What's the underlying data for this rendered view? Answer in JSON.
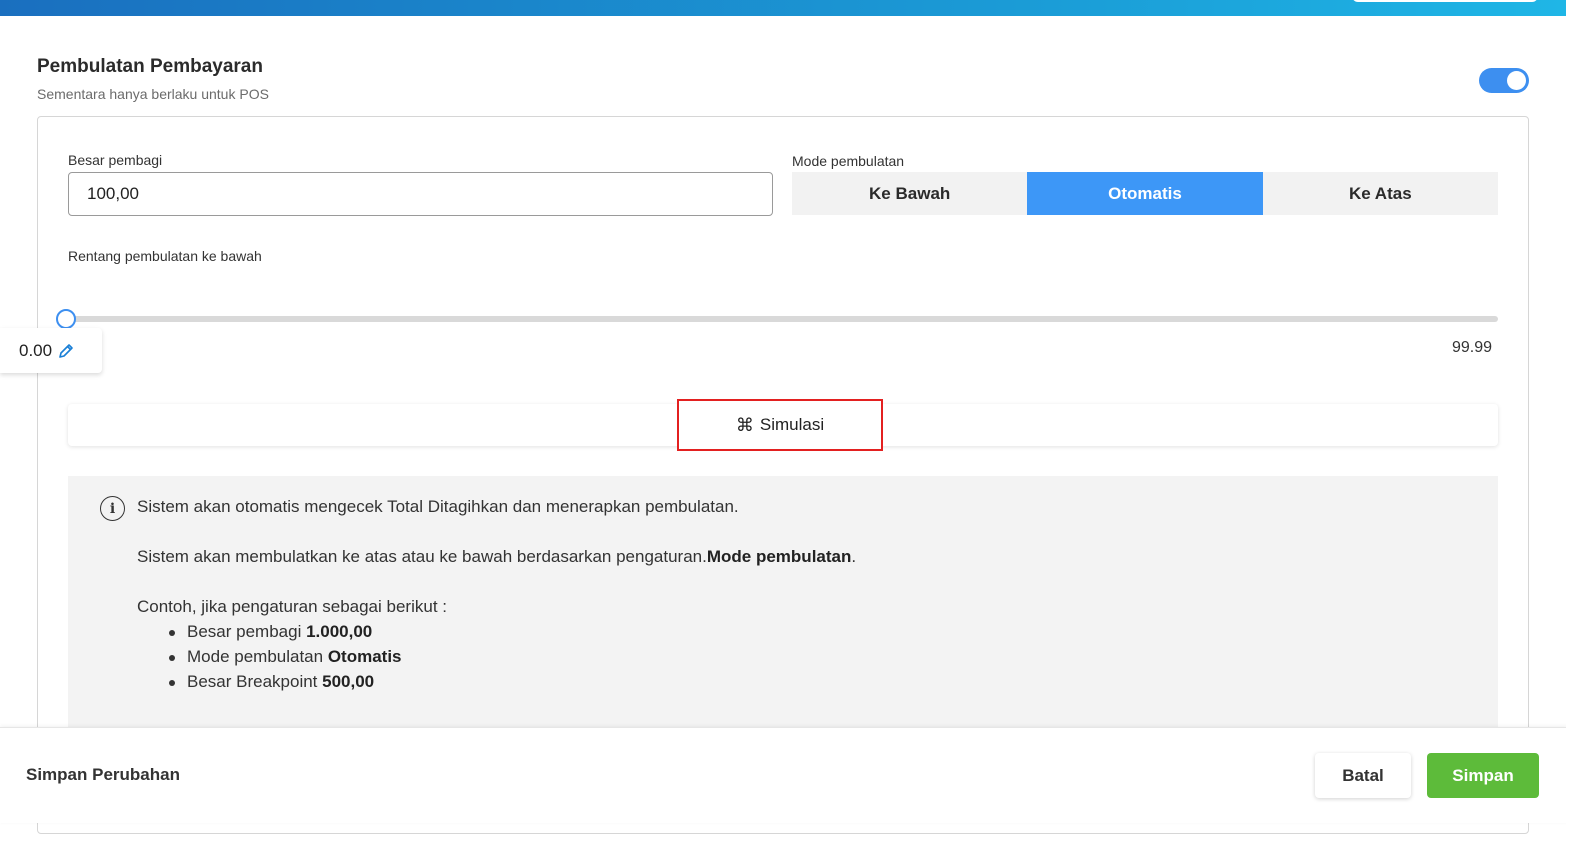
{
  "header": {
    "title": "Pembulatan Pembayaran",
    "subtitle": "Sementara hanya berlaku untuk POS",
    "toggle_enabled": true
  },
  "form": {
    "divisor_label": "Besar pembagi",
    "divisor_value": "100,00",
    "mode_label": "Mode pembulatan",
    "modes": [
      "Ke Bawah",
      "Otomatis",
      "Ke Atas"
    ],
    "selected_mode": "Otomatis",
    "range_label": "Rentang pembulatan ke bawah",
    "range_min": "0.00",
    "range_max": "99.99",
    "range_value": 0
  },
  "simulation": {
    "button_label": "Simulasi",
    "icon": "command-icon"
  },
  "info": {
    "icon": "info-icon",
    "line1": "Sistem akan otomatis mengecek Total Ditagihkan dan menerapkan pembulatan.",
    "line2_prefix": "Sistem akan membulatkan ke atas atau ke bawah berdasarkan pengaturan.",
    "line2_bold": "Mode pembulatan",
    "line2_suffix": ".",
    "example_intro": "Contoh, jika pengaturan sebagai berikut :",
    "examples": [
      {
        "text": "Besar pembagi ",
        "bold": "1.000,00"
      },
      {
        "text": "Mode pembulatan ",
        "bold": "Otomatis"
      },
      {
        "text": "Besar Breakpoint ",
        "bold": "500,00"
      }
    ]
  },
  "footer": {
    "title": "Simpan Perubahan",
    "cancel_label": "Batal",
    "save_label": "Simpan"
  },
  "colors": {
    "accent": "#3d97f7",
    "save": "#5dbb3a",
    "highlight": "#e32020"
  }
}
